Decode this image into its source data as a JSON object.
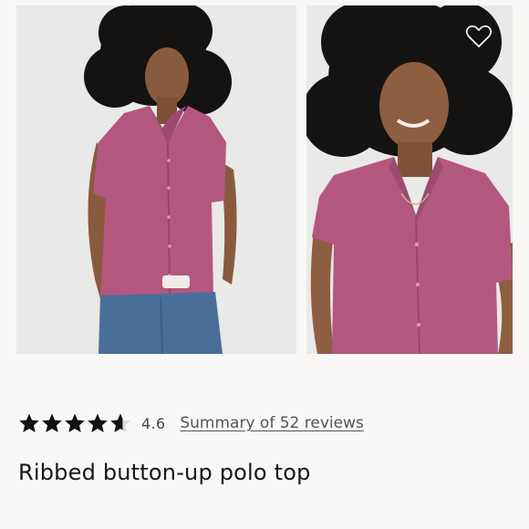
{
  "product": {
    "title": "Ribbed button-up polo top",
    "rating": {
      "value": 4.6,
      "value_label": "4.6",
      "stars_total": 5,
      "reviews_link_label": "Summary of 52 reviews"
    }
  },
  "gallery": {
    "images": [
      {
        "name": "product-photo-front-full",
        "subject": "model wearing pink ribbed polo top with jeans"
      },
      {
        "name": "product-photo-closeup",
        "subject": "model smiling wearing pink ribbed polo top"
      }
    ],
    "favorite_icon": "heart-outline-icon"
  },
  "colors": {
    "page_background": "#faf8f6",
    "photo_background": "#e8e8e7",
    "top_color": "#b4577f",
    "star_color": "#111111",
    "link_color": "#555555"
  }
}
